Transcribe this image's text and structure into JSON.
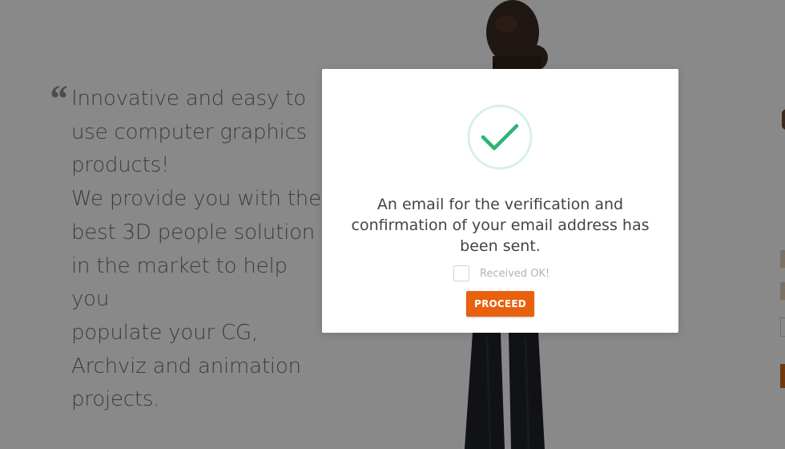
{
  "background": {
    "quote_mark": "“",
    "quote_lines": [
      "Innovative and easy to",
      "use computer graphics",
      "products!",
      "We provide you with the",
      "best 3D people solution",
      "in the market to help you",
      "populate your CG,",
      "Archviz and animation",
      "projects."
    ]
  },
  "modal": {
    "icon": "check-circle-icon",
    "message_lines": [
      "An email for the verification and",
      "confirmation of your email address has",
      "been sent."
    ],
    "checkbox_label": "Received OK!",
    "checkbox_checked": false,
    "proceed_label": "PROCEED"
  },
  "colors": {
    "accent": "#e8610e",
    "check_green": "#2bb673",
    "check_ring": "#d8f0e4",
    "overlay": "rgba(0,0,0,0.45)"
  }
}
